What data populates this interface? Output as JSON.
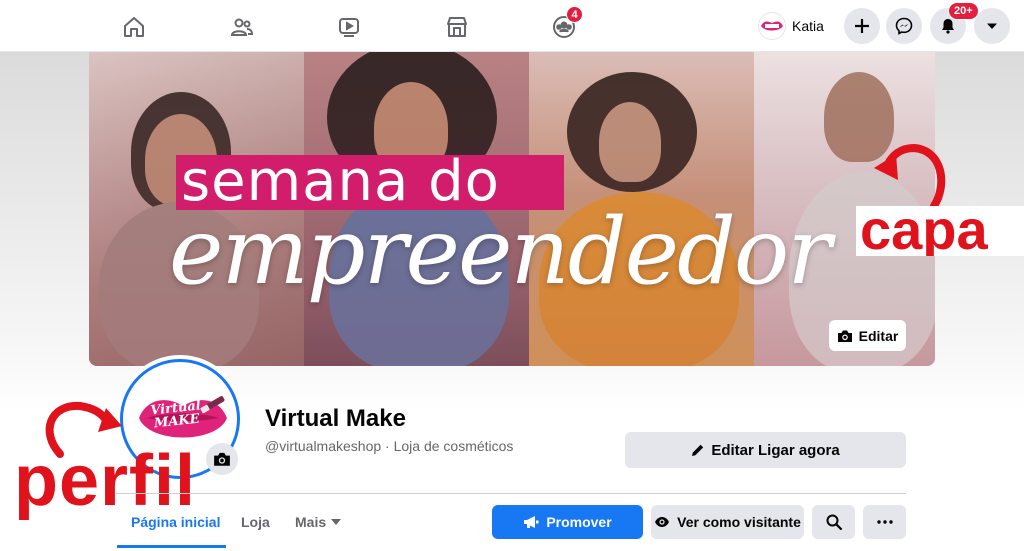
{
  "topnav": {
    "icons": [
      "home-icon",
      "friends-icon",
      "watch-icon",
      "marketplace-icon",
      "groups-icon"
    ],
    "groups_badge": "4",
    "user_name": "Katia",
    "notifications_badge": "20+"
  },
  "cover": {
    "title_line1": "semana do",
    "title_line2": "empreendedor",
    "edit_label": "Editar",
    "accent_color": "#d11d6b"
  },
  "annotations": {
    "cover_label": "capa",
    "profile_label": "perfil",
    "color": "#e0121c"
  },
  "profile": {
    "logo_text_line1": "Virtual",
    "logo_text_line2": "MAKE",
    "page_name": "Virtual Make",
    "page_subtitle": "@virtualmakeshop · Loja de cosméticos",
    "edit_cta_label": "Editar Ligar agora"
  },
  "tabs": {
    "home": "Página inicial",
    "store": "Loja",
    "more": "Mais"
  },
  "actions": {
    "promote": "Promover",
    "view_as": "Ver como visitante",
    "accent_color": "#1877f2"
  }
}
